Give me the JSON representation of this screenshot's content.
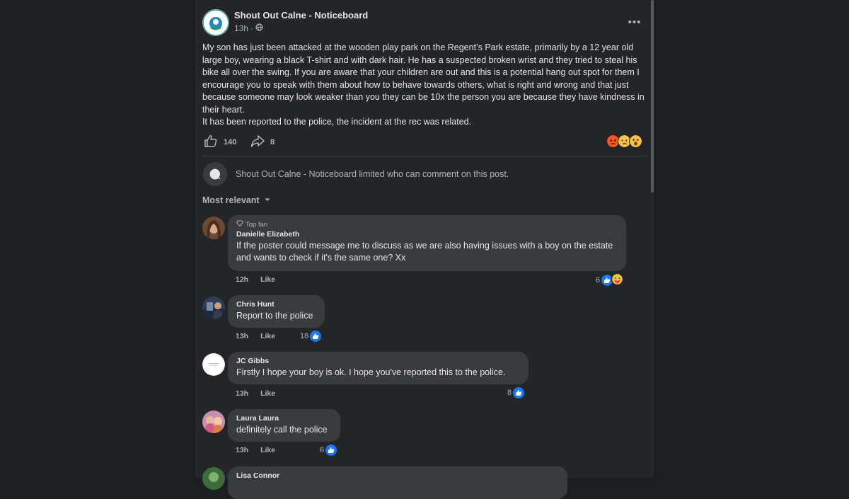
{
  "post": {
    "page_name": "Shout Out Calne - Noticeboard",
    "time": "13h",
    "privacy_icon": "globe-icon",
    "body": [
      "My son has just been attacked at the wooden play park on the Regent’s Park estate,  primarily by a 12 year old large boy, wearing a black T-shirt and with dark hair. He has a suspected broken wrist and they tried to steal his bike all over the swing. If you are aware that your children are out and this is a potential hang out spot for them I encourage you to speak with them about how to behave towards others, what is right and wrong and that just because someone may look weaker than you they can be 10x the person you are because they have kindness in their heart.",
      "It has been reported to the police, the incident at the rec was related."
    ],
    "like_count": "140",
    "share_count": "8",
    "reaction_icons": [
      "angry-emoji-icon",
      "sad-emoji-icon",
      "wow-emoji-icon"
    ]
  },
  "comments_info": {
    "limited_text": "Shout Out Calne - Noticeboard limited who can comment on this post.",
    "sort_label": "Most relevant"
  },
  "comments": [
    {
      "badge": "Top fan",
      "name": "Danielle Elizabeth",
      "text": "If the poster could message me to discuss as we are also having issues with a boy on the estate and wants to check if it's the same one? Xx",
      "time": "12h",
      "like_label": "Like",
      "reactions": "6"
    },
    {
      "name": "Chris Hunt",
      "text": "Report to the police",
      "time": "13h",
      "like_label": "Like",
      "reactions": "18"
    },
    {
      "name": "JC Gibbs",
      "text": "Firstly I hope your boy is ok. I hope you've reported this to the police.",
      "time": "13h",
      "like_label": "Like",
      "reactions": "8"
    },
    {
      "name": "Laura Laura",
      "text": "definitely call the police",
      "time": "13h",
      "like_label": "Like",
      "reactions": "6"
    },
    {
      "name": "Lisa Connor"
    }
  ],
  "colors": {
    "background": "#1c1e21",
    "card": "#242526",
    "bubble": "#3a3b3c",
    "primary_text": "#e4e6eb",
    "secondary_text": "#b0b3b8",
    "like_blue": "#1877f2"
  }
}
